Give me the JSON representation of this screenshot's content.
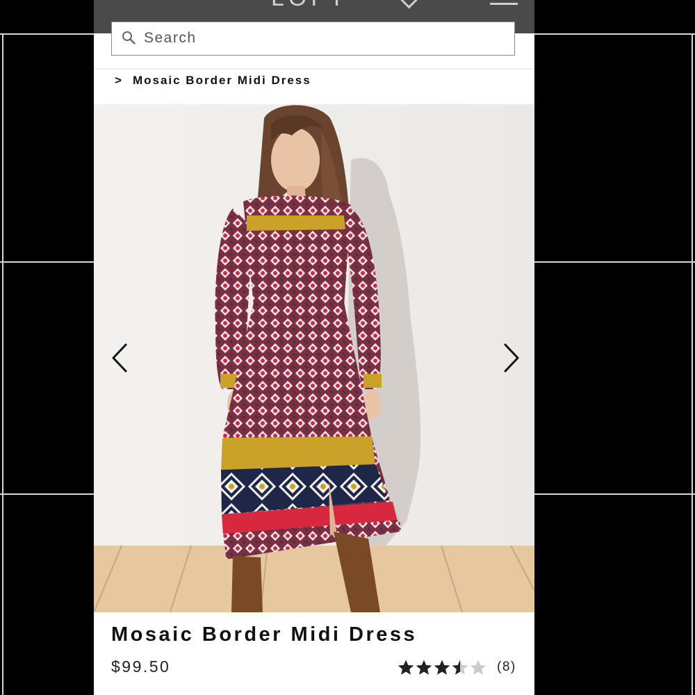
{
  "header": {
    "logo_text": "LOFT",
    "search": {
      "placeholder": "Search",
      "value": ""
    }
  },
  "breadcrumb": {
    "separator": ">",
    "current": "Mosaic Border Midi Dress"
  },
  "carousel": {
    "prev_icon": "chevron-left-icon",
    "next_icon": "chevron-right-icon"
  },
  "product": {
    "title": "Mosaic Border Midi Dress",
    "price": "$99.50",
    "rating": {
      "value": 3.5,
      "max": 5,
      "count_label": "(8)"
    }
  },
  "colors": {
    "dress_base": "#7a3042",
    "dress_border_yellow": "#c9a227",
    "dress_border_red": "#d6283f",
    "dress_border_navy": "#1f2748",
    "boots": "#7a4a26",
    "floor": "#e6c7a0",
    "wall": "#efedeb",
    "star_filled": "#222222",
    "star_empty": "#cccccc"
  }
}
